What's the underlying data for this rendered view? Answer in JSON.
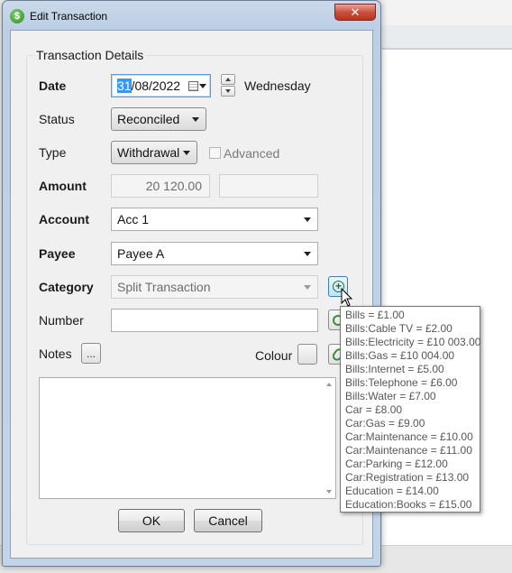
{
  "window": {
    "title": "Edit Transaction",
    "close_glyph": "✕",
    "app_icon_glyph": "$"
  },
  "group": {
    "title": "Transaction Details"
  },
  "date": {
    "label": "Date",
    "day_selected": "31",
    "rest": "/08/2022",
    "weekday": "Wednesday"
  },
  "status": {
    "label": "Status",
    "value": "Reconciled"
  },
  "type": {
    "label": "Type",
    "value": "Withdrawal",
    "advanced_label": "Advanced"
  },
  "amount": {
    "label": "Amount",
    "value": "20 120.00",
    "second_value": ""
  },
  "account": {
    "label": "Account",
    "value": "Acc 1"
  },
  "payee": {
    "label": "Payee",
    "value": "Payee A"
  },
  "category": {
    "label": "Category",
    "value": "Split Transaction"
  },
  "number": {
    "label": "Number",
    "value": ""
  },
  "notes": {
    "label": "Notes",
    "ellipsis": "...",
    "value": ""
  },
  "colour": {
    "label": "Colour"
  },
  "buttons": {
    "ok": "OK",
    "cancel": "Cancel"
  },
  "split_tooltip": {
    "lines": [
      "Bills = £1.00",
      "Bills:Cable TV = £2.00",
      "Bills:Electricity = £10 003.00",
      "Bills:Gas = £10 004.00",
      "Bills:Internet = £5.00",
      "Bills:Telephone = £6.00",
      "Bills:Water = £7.00",
      "Car = £8.00",
      "Car:Gas = £9.00",
      "Car:Maintenance = £10.00",
      "Car:Maintenance = £11.00",
      "Car:Parking = £12.00",
      "Car:Registration = £13.00",
      "Education = £14.00",
      "Education:Books = £15.00"
    ]
  },
  "icons": {
    "app": "dollar-coin-icon",
    "close": "close-icon",
    "calendar": "calendar-icon",
    "add_split": "plus-circle-icon",
    "number_action": "green-circle-icon",
    "attachment": "paperclip-icon",
    "cursor": "mouse-pointer-icon"
  },
  "colors": {
    "selection": "#3399ff",
    "close_button": "#c9513c",
    "title_bar": "#c2d4e8"
  }
}
